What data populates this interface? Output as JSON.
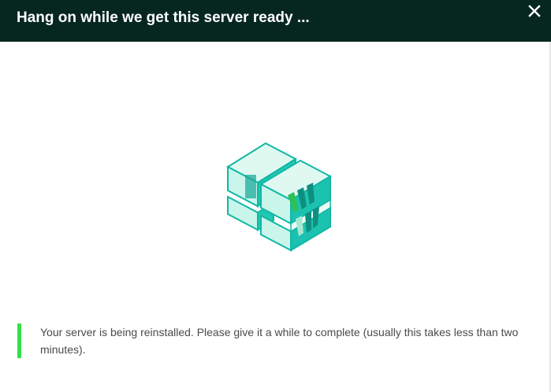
{
  "modal": {
    "title": "Hang on while we get this server ready ...",
    "close_icon": "close-icon"
  },
  "illustration": {
    "icon": "server-blocks-logo-icon",
    "colors": {
      "teal": "#1cc2b0",
      "light": "#c9f5ea",
      "dark": "#0e8f80",
      "green": "#36c95a"
    }
  },
  "notice": {
    "message": "Your server is being reinstalled. Please give it a while to complete (usually this takes less than two minutes).",
    "accent_color": "#33e046"
  },
  "colors": {
    "header_bg": "#06271f",
    "header_text": "#ffffff",
    "body_text": "#4a4a4a"
  }
}
